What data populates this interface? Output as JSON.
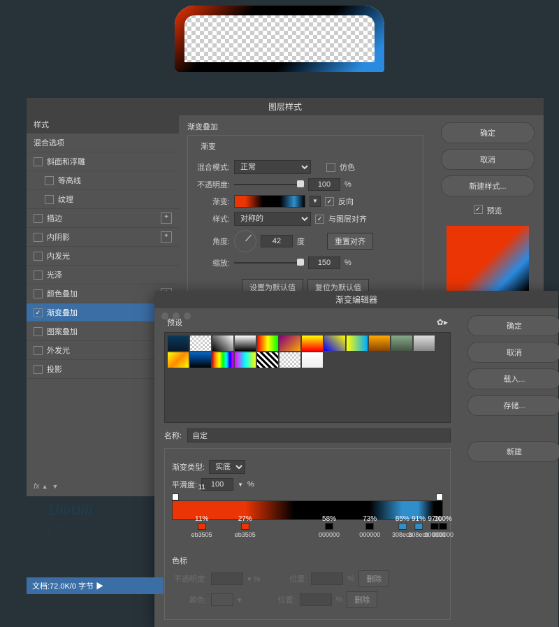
{
  "canvas_alt": "Rounded rectangle with gradient stroke",
  "dialog1": {
    "title": "图层样式",
    "sidebar_header": "样式",
    "blend_options": "混合选项",
    "styles": {
      "bevel": "斜面和浮雕",
      "contour": "等高线",
      "texture": "纹理",
      "stroke": "描边",
      "inner_shadow": "内阴影",
      "inner_glow": "内发光",
      "satin": "光泽",
      "color_overlay": "颜色叠加",
      "gradient_overlay": "渐变叠加",
      "pattern_overlay": "图案叠加",
      "outer_glow": "外发光",
      "drop_shadow": "投影"
    },
    "fx_label": "fx",
    "main": {
      "section_title": "渐变叠加",
      "group_label": "渐变",
      "blend_mode_label": "混合模式:",
      "blend_mode_value": "正常",
      "dither_label": "仿色",
      "opacity_label": "不透明度:",
      "opacity_value": "100",
      "opacity_unit": "%",
      "gradient_label": "渐变:",
      "reverse_label": "反向",
      "style_label": "样式:",
      "style_value": "对称的",
      "align_label": "与图层对齐",
      "angle_label": "角度:",
      "angle_value": "42",
      "angle_unit": "度",
      "reset_align": "重置对齐",
      "scale_label": "缩放:",
      "scale_value": "150",
      "scale_unit": "%",
      "make_default": "设置为默认值",
      "reset_default": "复位为默认值"
    },
    "buttons": {
      "ok": "确定",
      "cancel": "取消",
      "new_style": "新建样式...",
      "preview": "预览"
    }
  },
  "dialog2": {
    "title": "渐变编辑器",
    "presets_label": "预设",
    "name_label": "名称:",
    "name_value": "自定",
    "gradient_type_label": "渐变类型:",
    "gradient_type_value": "实底",
    "smoothness_label": "平滑度:",
    "smoothness_value": "100",
    "smoothness_unit": "%",
    "color_label": "色标",
    "stops": [
      {
        "pos": 11,
        "hex": "eb3505"
      },
      {
        "pos": 27,
        "hex": "eb3505"
      },
      {
        "pos": 58,
        "hex": "000000"
      },
      {
        "pos": 73,
        "hex": "000000"
      },
      {
        "pos": 85,
        "hex": "308ecb"
      },
      {
        "pos": 91,
        "hex": "308ecb"
      },
      {
        "pos": 97,
        "hex": "000000"
      },
      {
        "pos": 100,
        "hex": "000000"
      }
    ],
    "opacity_row_label": "不透明度:",
    "position_label": "位置:",
    "delete_label": "删除",
    "color_row_label": "颜色:",
    "buttons": {
      "ok": "确定",
      "cancel": "取消",
      "load": "载入...",
      "save": "存储...",
      "new": "新建"
    }
  },
  "statusbar": "文档:72.0K/0 字节",
  "watermark1": "UiiiUiii",
  "watermark2": "优优教程网"
}
